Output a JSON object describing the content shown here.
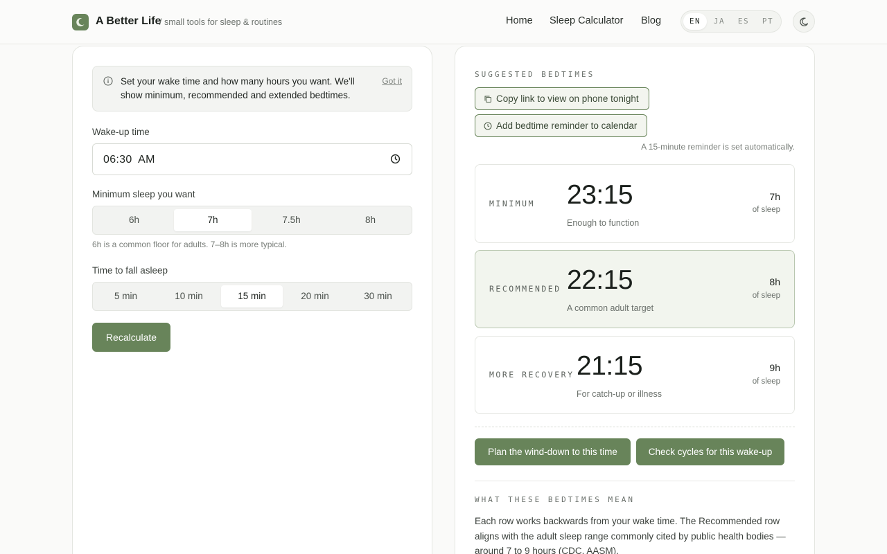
{
  "header": {
    "brand": "A Better Life",
    "tagline": "/ small tools for sleep & routines",
    "nav": [
      "Home",
      "Sleep Calculator",
      "Blog"
    ],
    "languages": [
      "EN",
      "JA",
      "ES",
      "PT"
    ],
    "active_language": "EN"
  },
  "calculator": {
    "info_text": "Set your wake time and how many hours you want. We'll show minimum, recommended and extended bedtimes.",
    "dismiss_label": "Got it",
    "wake_label": "Wake-up time",
    "wake_value": "06:30  AM",
    "min_sleep_label": "Minimum sleep you want",
    "sleep_options": [
      "6h",
      "7h",
      "7.5h",
      "8h"
    ],
    "sleep_selected": "7h",
    "sleep_hint": "6h is a common floor for adults. 7–8h is more typical.",
    "fall_asleep_label": "Time to fall asleep",
    "fall_options": [
      "5 min",
      "10 min",
      "15 min",
      "20 min",
      "30 min"
    ],
    "fall_selected": "15 min",
    "recalc_label": "Recalculate"
  },
  "results": {
    "title": "SUGGESTED BEDTIMES",
    "copy_link_label": "Copy link to view on phone tonight",
    "reminder_label": "Add bedtime reminder to calendar",
    "reminder_note": "A 15-minute reminder is set automatically.",
    "rows": [
      {
        "label": "MINIMUM",
        "time": "23:15",
        "sub": "Enough to function",
        "hours": "7h",
        "of": "of sleep"
      },
      {
        "label": "RECOMMENDED",
        "time": "22:15",
        "sub": "A common adult target",
        "hours": "8h",
        "of": "of sleep"
      },
      {
        "label": "MORE RECOVERY",
        "time": "21:15",
        "sub": "For catch-up or illness",
        "hours": "9h",
        "of": "of sleep"
      }
    ],
    "winddown_label": "Plan the wind-down to this time",
    "cycles_label": "Check cycles for this wake-up",
    "explain_title": "WHAT THESE BEDTIMES MEAN",
    "explain_text": "Each row works backwards from your wake time. The Recommended row aligns with the adult sleep range commonly cited by public health bodies — around 7 to 9 hours (CDC, AASM)."
  },
  "icons": {
    "logo": "moon-icon",
    "theme": "moon-icon",
    "info": "info-icon",
    "clock": "clock-icon",
    "copy": "copy-icon",
    "calendar_clock": "clock-icon"
  },
  "colors": {
    "accent": "#68845a",
    "recommended_bg": "#f2f5ee"
  }
}
